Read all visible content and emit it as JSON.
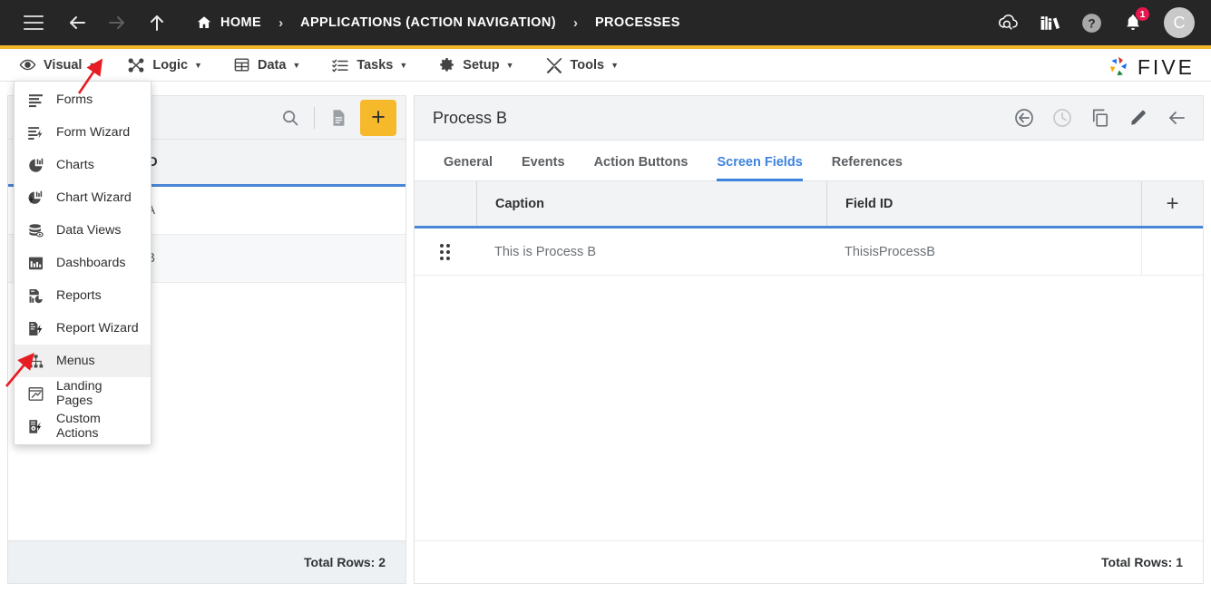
{
  "header": {
    "nav": {
      "menu_icon": "hamburger-icon",
      "back_icon": "back-arrow-icon",
      "forward_icon": "forward-arrow-icon",
      "up_icon": "up-arrow-icon"
    },
    "breadcrumb": [
      {
        "label": "HOME",
        "icon": "home-icon"
      },
      {
        "label": "APPLICATIONS (ACTION NAVIGATION)",
        "icon": ""
      },
      {
        "label": "PROCESSES",
        "icon": ""
      }
    ],
    "separator": "›",
    "right_icons": [
      {
        "name": "cloud-check-icon"
      },
      {
        "name": "books-icon"
      },
      {
        "name": "help-icon"
      },
      {
        "name": "bell-icon",
        "badge": "1"
      }
    ],
    "avatar": {
      "initial": "C"
    },
    "accent_color": "#f3b92c",
    "background_color": "#262626"
  },
  "menubar": {
    "items": [
      {
        "label": "Visual",
        "icon": "eye-icon",
        "caret": "▼"
      },
      {
        "label": "Logic",
        "icon": "logic-nodes-icon",
        "caret": "▼"
      },
      {
        "label": "Data",
        "icon": "table-grid-icon",
        "caret": "▼"
      },
      {
        "label": "Tasks",
        "icon": "task-list-icon",
        "caret": "▼"
      },
      {
        "label": "Setup",
        "icon": "gear-icon",
        "caret": "▼"
      },
      {
        "label": "Tools",
        "icon": "tools-icon",
        "caret": "▼"
      }
    ],
    "brand": {
      "text": "FIVE",
      "logo": "five-pinwheel-logo"
    }
  },
  "dropdown": {
    "open_for": "Visual",
    "items": [
      {
        "label": "Forms",
        "icon": "forms-icon",
        "active": false
      },
      {
        "label": "Form Wizard",
        "icon": "form-wizard-icon",
        "active": false
      },
      {
        "label": "Charts",
        "icon": "charts-icon",
        "active": false
      },
      {
        "label": "Chart Wizard",
        "icon": "chart-wizard-icon",
        "active": false
      },
      {
        "label": "Data Views",
        "icon": "data-views-icon",
        "active": false
      },
      {
        "label": "Dashboards",
        "icon": "dashboards-icon",
        "active": false
      },
      {
        "label": "Reports",
        "icon": "reports-icon",
        "active": false
      },
      {
        "label": "Report Wizard",
        "icon": "report-wizard-icon",
        "active": false
      },
      {
        "label": "Menus",
        "icon": "menus-icon",
        "active": true
      },
      {
        "label": "Landing Pages",
        "icon": "landing-pages-icon",
        "active": false
      },
      {
        "label": "Custom Actions",
        "icon": "custom-actions-icon",
        "active": false
      }
    ]
  },
  "left_panel": {
    "toolbar": {
      "search_icon": "search-icon",
      "document_icon": "document-icon",
      "add_label": "+",
      "add_color": "#f6b92b"
    },
    "grid": {
      "columns": [
        "Action ID"
      ],
      "rows": [
        {
          "action_id": "ProcessA",
          "selected": false
        },
        {
          "action_id": "ProcessB",
          "selected": true
        }
      ],
      "footer": "Total Rows: 2"
    }
  },
  "right_panel": {
    "title": "Process B",
    "actions": [
      {
        "name": "revert-icon",
        "disabled": false
      },
      {
        "name": "history-clock-icon",
        "disabled": true
      },
      {
        "name": "duplicate-icon",
        "disabled": false
      },
      {
        "name": "edit-pencil-icon",
        "disabled": false
      },
      {
        "name": "back-arrow-icon",
        "disabled": false
      }
    ],
    "tabs": [
      {
        "label": "General",
        "active": false
      },
      {
        "label": "Events",
        "active": false
      },
      {
        "label": "Action Buttons",
        "active": false
      },
      {
        "label": "Screen Fields",
        "active": true
      },
      {
        "label": "References",
        "active": false
      }
    ],
    "grid": {
      "columns": [
        "Caption",
        "Field ID"
      ],
      "add_label": "+",
      "rows": [
        {
          "caption": "This is Process B",
          "field_id": "ThisisProcessB"
        }
      ],
      "footer": "Total Rows: 1"
    }
  },
  "annotations": {
    "color": "#e81c23",
    "arrows": [
      {
        "name": "arrow-to-visual-caret"
      },
      {
        "name": "arrow-to-menus-item"
      }
    ]
  }
}
